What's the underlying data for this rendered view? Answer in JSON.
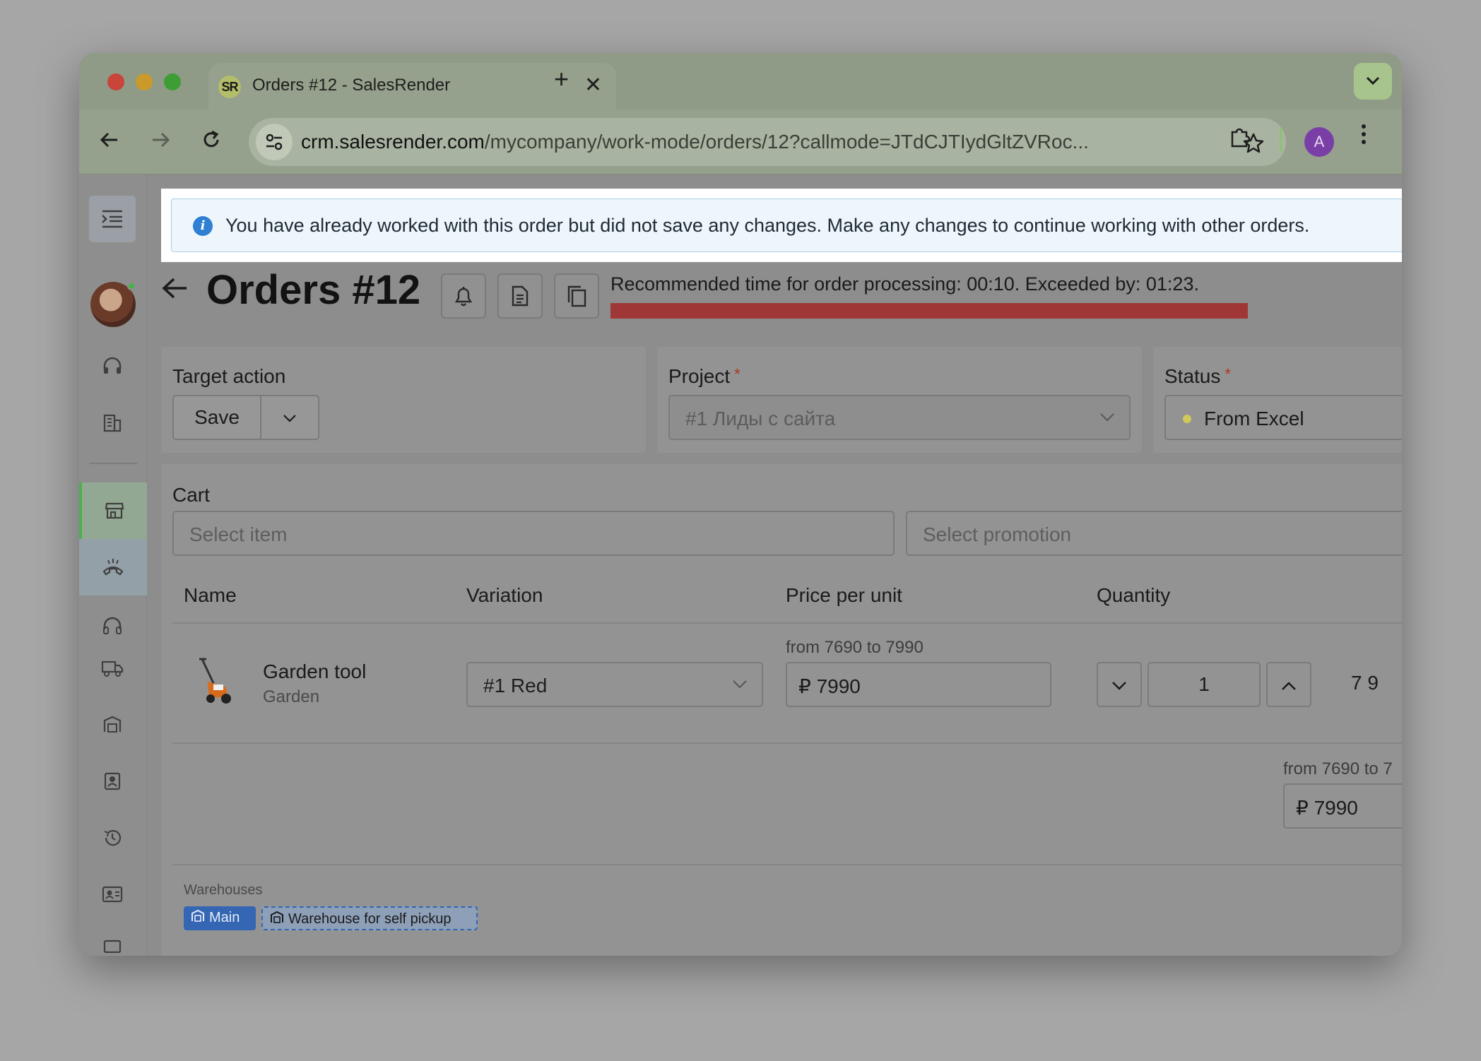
{
  "browser": {
    "tab_favicon": "SR",
    "tab_title": "Orders #12 - SalesRender",
    "tab_close": "✕",
    "new_tab": "+",
    "tab_menu": "⌄",
    "url_host": "crm.salesrender.com",
    "url_path": "/mycompany/work-mode/orders/12?callmode=JTdCJTIydGltZVRoc...",
    "profile_initial": "A"
  },
  "banner": {
    "icon": "i",
    "text": "You have already worked with this order but did not save any changes. Make any changes to continue working with other orders."
  },
  "header": {
    "title": "Orders #12",
    "timer_text": "Recommended time for order processing: 00:10. Exceeded by: 01:23."
  },
  "target_action": {
    "label": "Target action",
    "save_label": "Save"
  },
  "project": {
    "label": "Project",
    "required": "*",
    "value": "#1 Лиды с сайта"
  },
  "status": {
    "label": "Status",
    "required": "*",
    "value": "From Excel"
  },
  "cart": {
    "label": "Cart",
    "item_placeholder": "Select item",
    "promo_placeholder": "Select promotion",
    "columns": [
      "Name",
      "Variation",
      "Price per unit",
      "Quantity"
    ],
    "items": [
      {
        "name": "Garden tool",
        "category": "Garden",
        "variation": "#1 Red",
        "price_range": "from 7690 to 7990",
        "price": "₽ 7990",
        "quantity": "1",
        "total": "7 9"
      }
    ],
    "extra_price_range": "from 7690 to 7",
    "extra_price": "₽ 7990",
    "warehouses_label": "Warehouses",
    "warehouses": [
      "Main",
      "Warehouse for self pickup"
    ]
  }
}
